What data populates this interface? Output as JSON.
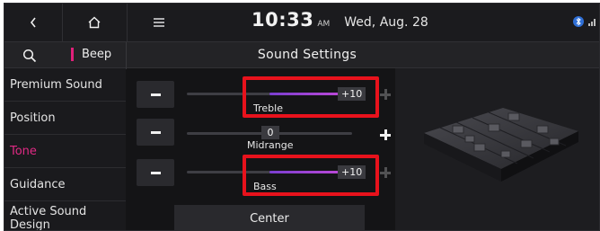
{
  "status_bar": {
    "back_icon": "chevron-left-icon",
    "home_icon": "home-icon",
    "menu_icon": "hamburger-menu-icon",
    "time": "10:33",
    "ampm": "AM",
    "date": "Wed, Aug. 28",
    "status_icons": [
      "bluetooth-audio-icon",
      "signal-icon"
    ]
  },
  "title_bar": {
    "search_icon": "search-icon",
    "beep_label": "Beep",
    "title": "Sound Settings"
  },
  "sidebar": {
    "items": [
      {
        "label": "Premium Sound",
        "active": false
      },
      {
        "label": "Position",
        "active": false
      },
      {
        "label": "Tone",
        "active": true
      },
      {
        "label": "Guidance",
        "active": false
      },
      {
        "label": "Active Sound Design",
        "active": false
      }
    ]
  },
  "sliders": [
    {
      "name": "Treble",
      "value": "+10",
      "level": 10,
      "min": -10,
      "max": 10,
      "highlighted": true
    },
    {
      "name": "Midrange",
      "value": "0",
      "level": 0,
      "min": -10,
      "max": 10,
      "highlighted": false
    },
    {
      "name": "Bass",
      "value": "+10",
      "level": 10,
      "min": -10,
      "max": 10,
      "highlighted": true
    }
  ],
  "center_button": "Center",
  "colors": {
    "accent": "#e02a84",
    "slider_fill": "#b046d8",
    "highlight_box": "#e8121c",
    "background": "#141416"
  }
}
